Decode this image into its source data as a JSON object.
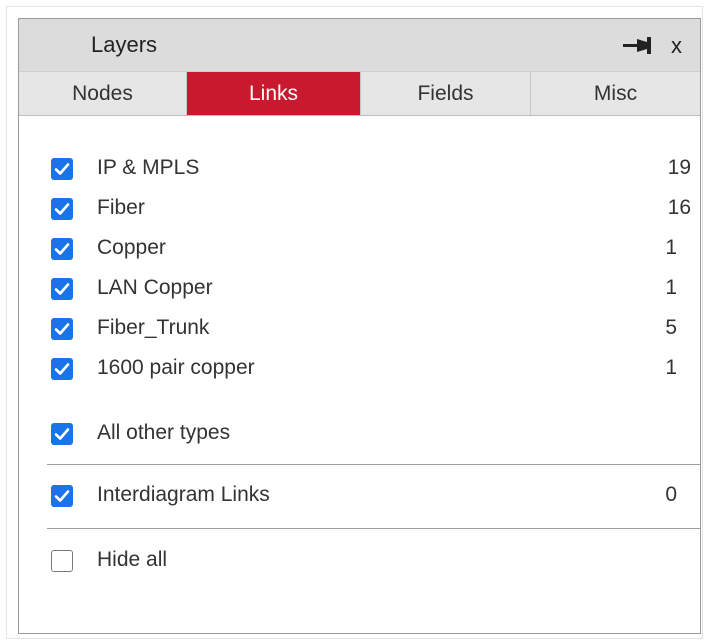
{
  "panel": {
    "title": "Layers"
  },
  "tabs": [
    {
      "label": "Nodes",
      "active": false
    },
    {
      "label": "Links",
      "active": true
    },
    {
      "label": "Fields",
      "active": false
    },
    {
      "label": "Misc",
      "active": false
    }
  ],
  "links": [
    {
      "label": "IP & MPLS",
      "count": "19",
      "checked": true
    },
    {
      "label": "Fiber",
      "count": "16",
      "checked": true
    },
    {
      "label": "Copper",
      "count": "1",
      "checked": true
    },
    {
      "label": "LAN Copper",
      "count": "1",
      "checked": true
    },
    {
      "label": "Fiber_Trunk",
      "count": "5",
      "checked": true
    },
    {
      "label": "1600 pair copper",
      "count": "1",
      "checked": true
    }
  ],
  "all_other": {
    "label": "All other types",
    "checked": true
  },
  "interdiagram": {
    "label": "Interdiagram Links",
    "count": "0",
    "checked": true
  },
  "hide_all": {
    "label": "Hide all",
    "checked": false
  },
  "colors": {
    "accent": "#c8192e",
    "checkbox": "#1a73e8"
  },
  "icons": {
    "pin": "pin-icon",
    "close": "close-icon",
    "check": "checkmark-icon"
  }
}
